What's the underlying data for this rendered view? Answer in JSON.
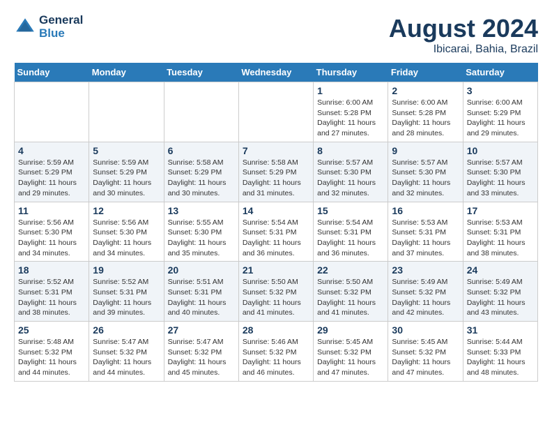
{
  "header": {
    "logo_line1": "General",
    "logo_line2": "Blue",
    "month_title": "August 2024",
    "location": "Ibicarai, Bahia, Brazil"
  },
  "days_of_week": [
    "Sunday",
    "Monday",
    "Tuesday",
    "Wednesday",
    "Thursday",
    "Friday",
    "Saturday"
  ],
  "weeks": [
    [
      {
        "day": "",
        "info": ""
      },
      {
        "day": "",
        "info": ""
      },
      {
        "day": "",
        "info": ""
      },
      {
        "day": "",
        "info": ""
      },
      {
        "day": "1",
        "info": "Sunrise: 6:00 AM\nSunset: 5:28 PM\nDaylight: 11 hours and 27 minutes."
      },
      {
        "day": "2",
        "info": "Sunrise: 6:00 AM\nSunset: 5:28 PM\nDaylight: 11 hours and 28 minutes."
      },
      {
        "day": "3",
        "info": "Sunrise: 6:00 AM\nSunset: 5:29 PM\nDaylight: 11 hours and 29 minutes."
      }
    ],
    [
      {
        "day": "4",
        "info": "Sunrise: 5:59 AM\nSunset: 5:29 PM\nDaylight: 11 hours and 29 minutes."
      },
      {
        "day": "5",
        "info": "Sunrise: 5:59 AM\nSunset: 5:29 PM\nDaylight: 11 hours and 30 minutes."
      },
      {
        "day": "6",
        "info": "Sunrise: 5:58 AM\nSunset: 5:29 PM\nDaylight: 11 hours and 30 minutes."
      },
      {
        "day": "7",
        "info": "Sunrise: 5:58 AM\nSunset: 5:29 PM\nDaylight: 11 hours and 31 minutes."
      },
      {
        "day": "8",
        "info": "Sunrise: 5:57 AM\nSunset: 5:30 PM\nDaylight: 11 hours and 32 minutes."
      },
      {
        "day": "9",
        "info": "Sunrise: 5:57 AM\nSunset: 5:30 PM\nDaylight: 11 hours and 32 minutes."
      },
      {
        "day": "10",
        "info": "Sunrise: 5:57 AM\nSunset: 5:30 PM\nDaylight: 11 hours and 33 minutes."
      }
    ],
    [
      {
        "day": "11",
        "info": "Sunrise: 5:56 AM\nSunset: 5:30 PM\nDaylight: 11 hours and 34 minutes."
      },
      {
        "day": "12",
        "info": "Sunrise: 5:56 AM\nSunset: 5:30 PM\nDaylight: 11 hours and 34 minutes."
      },
      {
        "day": "13",
        "info": "Sunrise: 5:55 AM\nSunset: 5:30 PM\nDaylight: 11 hours and 35 minutes."
      },
      {
        "day": "14",
        "info": "Sunrise: 5:54 AM\nSunset: 5:31 PM\nDaylight: 11 hours and 36 minutes."
      },
      {
        "day": "15",
        "info": "Sunrise: 5:54 AM\nSunset: 5:31 PM\nDaylight: 11 hours and 36 minutes."
      },
      {
        "day": "16",
        "info": "Sunrise: 5:53 AM\nSunset: 5:31 PM\nDaylight: 11 hours and 37 minutes."
      },
      {
        "day": "17",
        "info": "Sunrise: 5:53 AM\nSunset: 5:31 PM\nDaylight: 11 hours and 38 minutes."
      }
    ],
    [
      {
        "day": "18",
        "info": "Sunrise: 5:52 AM\nSunset: 5:31 PM\nDaylight: 11 hours and 38 minutes."
      },
      {
        "day": "19",
        "info": "Sunrise: 5:52 AM\nSunset: 5:31 PM\nDaylight: 11 hours and 39 minutes."
      },
      {
        "day": "20",
        "info": "Sunrise: 5:51 AM\nSunset: 5:31 PM\nDaylight: 11 hours and 40 minutes."
      },
      {
        "day": "21",
        "info": "Sunrise: 5:50 AM\nSunset: 5:32 PM\nDaylight: 11 hours and 41 minutes."
      },
      {
        "day": "22",
        "info": "Sunrise: 5:50 AM\nSunset: 5:32 PM\nDaylight: 11 hours and 41 minutes."
      },
      {
        "day": "23",
        "info": "Sunrise: 5:49 AM\nSunset: 5:32 PM\nDaylight: 11 hours and 42 minutes."
      },
      {
        "day": "24",
        "info": "Sunrise: 5:49 AM\nSunset: 5:32 PM\nDaylight: 11 hours and 43 minutes."
      }
    ],
    [
      {
        "day": "25",
        "info": "Sunrise: 5:48 AM\nSunset: 5:32 PM\nDaylight: 11 hours and 44 minutes."
      },
      {
        "day": "26",
        "info": "Sunrise: 5:47 AM\nSunset: 5:32 PM\nDaylight: 11 hours and 44 minutes."
      },
      {
        "day": "27",
        "info": "Sunrise: 5:47 AM\nSunset: 5:32 PM\nDaylight: 11 hours and 45 minutes."
      },
      {
        "day": "28",
        "info": "Sunrise: 5:46 AM\nSunset: 5:32 PM\nDaylight: 11 hours and 46 minutes."
      },
      {
        "day": "29",
        "info": "Sunrise: 5:45 AM\nSunset: 5:32 PM\nDaylight: 11 hours and 47 minutes."
      },
      {
        "day": "30",
        "info": "Sunrise: 5:45 AM\nSunset: 5:32 PM\nDaylight: 11 hours and 47 minutes."
      },
      {
        "day": "31",
        "info": "Sunrise: 5:44 AM\nSunset: 5:33 PM\nDaylight: 11 hours and 48 minutes."
      }
    ]
  ]
}
